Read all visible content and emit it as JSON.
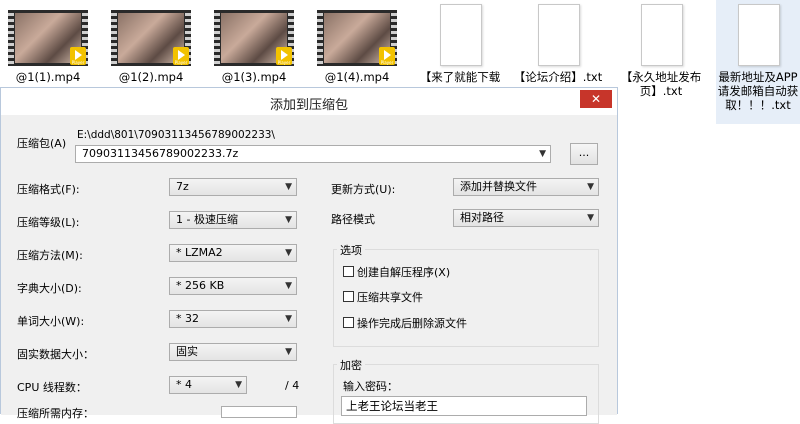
{
  "desktop": {
    "videos": [
      {
        "name": "@1(1).mp4"
      },
      {
        "name": "@1(2).mp4"
      },
      {
        "name": "@1(3).mp4"
      },
      {
        "name": "@1(4).mp4"
      }
    ],
    "player_badge": "Player",
    "docs": [
      {
        "name": "【来了就能下载"
      },
      {
        "name": "【论坛介绍】.txt"
      },
      {
        "name": "【永久地址发布页】.txt"
      },
      {
        "name": "最新地址及APP请发邮箱自动获取！！！.txt"
      }
    ]
  },
  "dialog": {
    "title": "添加到压缩包",
    "close_glyph": "✕",
    "archive": {
      "label": "压缩包(A)",
      "path": "E:\\ddd\\801\\70903113456789002233\\",
      "filename": "70903113456789002233.7z",
      "browse_label": "..."
    },
    "left": {
      "format": {
        "label": "压缩格式(F):",
        "value": "7z"
      },
      "level": {
        "label": "压缩等级(L):",
        "value": "1 - 极速压缩"
      },
      "method": {
        "label": "压缩方法(M):",
        "value": "*  LZMA2"
      },
      "dict": {
        "label": "字典大小(D):",
        "value": "*  256 KB"
      },
      "word": {
        "label": "单词大小(W):",
        "value": "*  32"
      },
      "solid": {
        "label": "固实数据大小：",
        "value": "固实"
      },
      "threads": {
        "label": "CPU 线程数：",
        "value": "*  4",
        "total": "/ 4"
      },
      "memory": {
        "label": "压缩所需内存："
      }
    },
    "right": {
      "update": {
        "label": "更新方式(U):",
        "value": "添加并替换文件"
      },
      "pathmode": {
        "label": "路径模式",
        "value": "相对路径"
      },
      "options": {
        "title": "选项",
        "items": [
          {
            "label": "创建自解压程序(X)"
          },
          {
            "label": "压缩共享文件"
          },
          {
            "label": "操作完成后删除源文件"
          }
        ]
      },
      "encrypt": {
        "title": "加密",
        "password_label": "输入密码：",
        "password_value": "上老王论坛当老王"
      }
    }
  }
}
